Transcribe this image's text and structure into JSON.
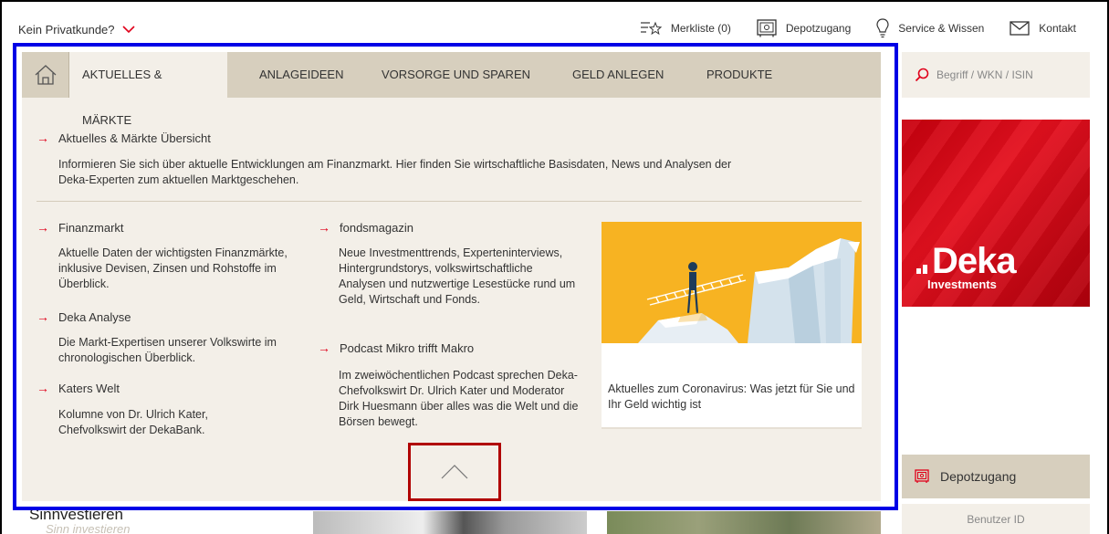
{
  "topbar": {
    "customer_switch": "Kein Privatkunde?",
    "merkliste": "Merkliste (0)",
    "depotzugang": "Depotzugang",
    "service": "Service & Wissen",
    "kontakt": "Kontakt"
  },
  "nav": {
    "tabs": [
      {
        "label": "AKTUELLES & MÄRKTE",
        "active": true
      },
      {
        "label": "ANLAGEIDEEN",
        "active": false
      },
      {
        "label": "VORSORGE UND SPAREN",
        "active": false
      },
      {
        "label": "GELD ANLEGEN",
        "active": false
      },
      {
        "label": "PRODUKTE",
        "active": false
      }
    ]
  },
  "menu": {
    "overview": {
      "title": "Aktuelles & Märkte Übersicht",
      "desc": "Informieren Sie sich über aktuelle Entwicklungen am Finanzmarkt. Hier finden Sie wirtschaftliche Basisdaten, News und Analysen der Deka-Experten zum aktuellen Marktgeschehen."
    },
    "items": [
      {
        "title": "Finanzmarkt",
        "desc": "Aktuelle Daten der wichtigsten Finanzmärkte, inklusive Devisen, Zinsen und Rohstoffe im Überblick."
      },
      {
        "title": "Deka Analyse",
        "desc": "Die Markt-Expertisen unserer Volkswirte im chronologischen Überblick."
      },
      {
        "title": "Katers Welt",
        "desc": "Kolumne von Dr. Ulrich Kater, Chefvolkswirt der DekaBank."
      },
      {
        "title": "fondsmagazin",
        "desc": "Neue Investmenttrends, Experteninterviews, Hintergrundstorys, volkswirtschaftliche Analysen und nutzwertige Lesestücke rund um Geld, Wirtschaft und Fonds."
      },
      {
        "title": "Podcast Mikro trifft Makro",
        "desc": "Im zweiwöchentlichen Podcast sprechen Deka-Chefvolkswirt Dr. Ulrich Kater und Moderator Dirk Huesmann über alles was die Welt und die Börsen bewegt."
      }
    ],
    "feature_caption": "Aktuelles zum Coronavirus: Was jetzt für Sie und Ihr Geld wichtig ist"
  },
  "sidebar": {
    "search_placeholder": "Begriff / WKN / ISIN",
    "banner_brand": "Deka",
    "banner_sub": "Investments",
    "depot_label": "Depotzugang",
    "user_id_label": "Benutzer ID"
  },
  "peek": {
    "title": "Sinnvestieren",
    "script": "Sinn investieren"
  },
  "colors": {
    "accent_red": "#e0001a",
    "nav_bg": "#d7cfbe",
    "panel_bg": "#f3efe8",
    "highlight_blue": "#0000e6",
    "highlight_red": "#b00000"
  },
  "icons": {
    "home": "home-icon",
    "merkliste": "star-list-icon",
    "depot": "safe-icon",
    "service": "lightbulb-icon",
    "kontakt": "envelope-icon",
    "search": "search-icon",
    "collapse": "chevron-up-icon",
    "arrow": "arrow-right-icon"
  }
}
